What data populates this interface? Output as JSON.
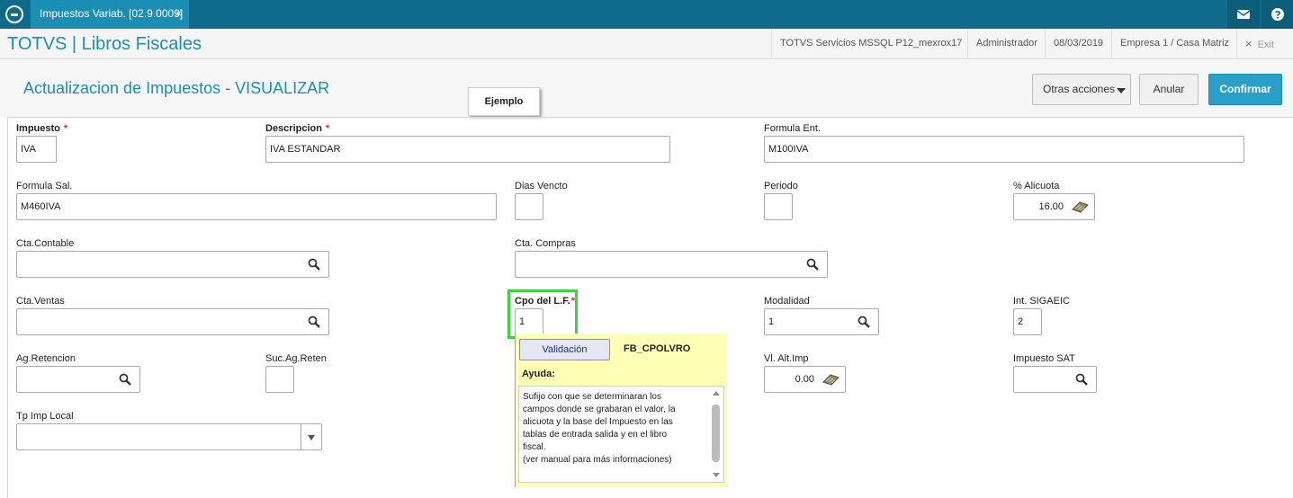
{
  "tab": {
    "label": "Impuestos Variab. [02.9.0009]",
    "close": "×"
  },
  "header": {
    "brand": "TOTVS | Libros Fiscales",
    "server": "TOTVS Servicios MSSQL P12_mexrox17",
    "user": "Administrador",
    "date": "08/03/2019",
    "company": "Empresa 1 / Casa Matriz",
    "exit_label": "Exit",
    "exit_icon": "×"
  },
  "page": {
    "title": "Actualizacion de Impuestos - VISUALIZAR",
    "tooltip": "Ejemplo"
  },
  "actions": {
    "otras": "Otras acciones",
    "anular": "Anular",
    "confirmar": "Confirmar"
  },
  "required_mark": "*",
  "form": {
    "impuesto": {
      "label": "Impuesto",
      "value": "IVA"
    },
    "descripcion": {
      "label": "Descripcion",
      "value": "IVA ESTANDAR"
    },
    "formula_ent": {
      "label": "Formula Ent.",
      "value": "M100IVA"
    },
    "formula_sal": {
      "label": "Formula Sal.",
      "value": "M460IVA"
    },
    "dias_vencto": {
      "label": "Dias Vencto",
      "value": ""
    },
    "periodo": {
      "label": "Periodo",
      "value": ""
    },
    "alicuota": {
      "label": "% Alicuota",
      "value": "16.00"
    },
    "cta_contable": {
      "label": "Cta.Contable",
      "value": ""
    },
    "cta_compras": {
      "label": "Cta. Compras",
      "value": ""
    },
    "cta_ventas": {
      "label": "Cta.Ventas",
      "value": ""
    },
    "cpo_lf": {
      "label": "Cpo del L.F.",
      "value": "1"
    },
    "modalidad": {
      "label": "Modalidad",
      "value": "1"
    },
    "int_sigaeic": {
      "label": "Int. SIGAEIC",
      "value": "2"
    },
    "ag_retencion": {
      "label": "Ag.Retencion",
      "value": ""
    },
    "suc_ag_reten": {
      "label": "Suc.Ag.Reten",
      "value": ""
    },
    "vl_alt_imp": {
      "label": "Vl. Alt.Imp",
      "value": "0.00"
    },
    "impuesto_sat": {
      "label": "Impuesto SAT",
      "value": ""
    },
    "tp_imp_local": {
      "label": "Tp Imp Local",
      "value": ""
    }
  },
  "help": {
    "validacion": "Validación",
    "code": "FB_CPOLVRO",
    "ayuda": "Ayuda:",
    "text": "Sufijo con que se determinaran los\ncampos donde se grabaran el valor, la\nalicuota y la base del Impuesto en las\ntablas de entrada salida y en el libro\nfiscal.\n(ver manual para más informaciones)"
  },
  "colors": {
    "accent": "#1a8fb3",
    "topbar": "#0e6b8a",
    "confirm": "#2a9fc9",
    "required": "#d9262b",
    "highlight": "#3fd13f",
    "help_bg": "#fffeb5"
  }
}
